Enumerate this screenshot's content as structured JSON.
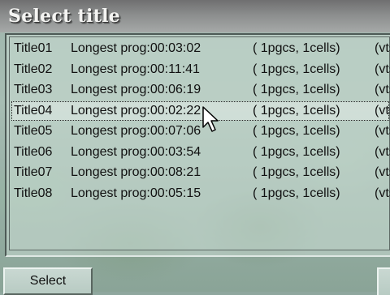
{
  "dialog": {
    "title": "Select title"
  },
  "titles": [
    {
      "title": "Title01",
      "prog": "Longest prog:00:03:02",
      "pgcs": "( 1pgcs,   1cells)",
      "vts": "(vts"
    },
    {
      "title": "Title02",
      "prog": "Longest prog:00:11:41",
      "pgcs": "( 1pgcs,   1cells)",
      "vts": "(vts"
    },
    {
      "title": "Title03",
      "prog": "Longest prog:00:06:19",
      "pgcs": "( 1pgcs,   1cells)",
      "vts": "(vts"
    },
    {
      "title": "Title04",
      "prog": "Longest prog:00:02:22",
      "pgcs": "( 1pgcs,   1cells)",
      "vts": "(vts",
      "selected": true
    },
    {
      "title": "Title05",
      "prog": "Longest prog:00:07:06",
      "pgcs": "( 1pgcs,   1cells)",
      "vts": "(vts"
    },
    {
      "title": "Title06",
      "prog": "Longest prog:00:03:54",
      "pgcs": "( 1pgcs,   1cells)",
      "vts": "(vts"
    },
    {
      "title": "Title07",
      "prog": "Longest prog:00:08:21",
      "pgcs": "( 1pgcs,   1cells)",
      "vts": "(vts"
    },
    {
      "title": "Title08",
      "prog": "Longest prog:00:05:15",
      "pgcs": "( 1pgcs,   1cells)",
      "vts": "(vts"
    }
  ],
  "buttons": {
    "select_label": "Select"
  },
  "icons": {
    "cursor": "mouse-pointer-icon"
  }
}
